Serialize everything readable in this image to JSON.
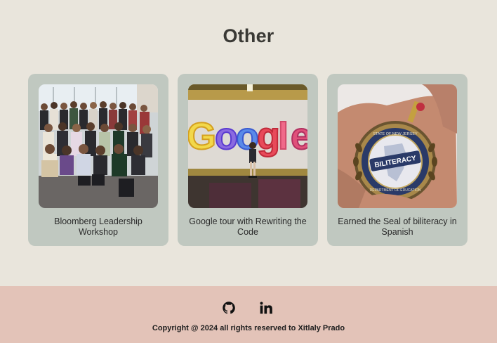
{
  "section": {
    "title": "Other"
  },
  "cards": [
    {
      "caption": "Bloomberg Leadership Workshop",
      "image_label": "group-photo"
    },
    {
      "caption": "Google tour with Rewriting the Code",
      "image_label": "google-sign-photo"
    },
    {
      "caption": "Earned the Seal of biliteracy in Spanish",
      "image_label": "biliteracy-medal-photo",
      "medal_text": {
        "center": "BILITERACY",
        "top_ring": "STATE OF NEW JERSEY",
        "bottom_ring": "DEPARTMENT OF EDUCATION"
      }
    }
  ],
  "footer": {
    "github_icon": "github-icon",
    "linkedin_icon": "linkedin-icon",
    "copyright": "Copyright @ 2024 all rights reserved to Xitlaly Prado"
  },
  "colors": {
    "page_bg": "#e9e5dc",
    "card_bg": "#c0c8c0",
    "footer_bg": "#e3c3b8"
  }
}
